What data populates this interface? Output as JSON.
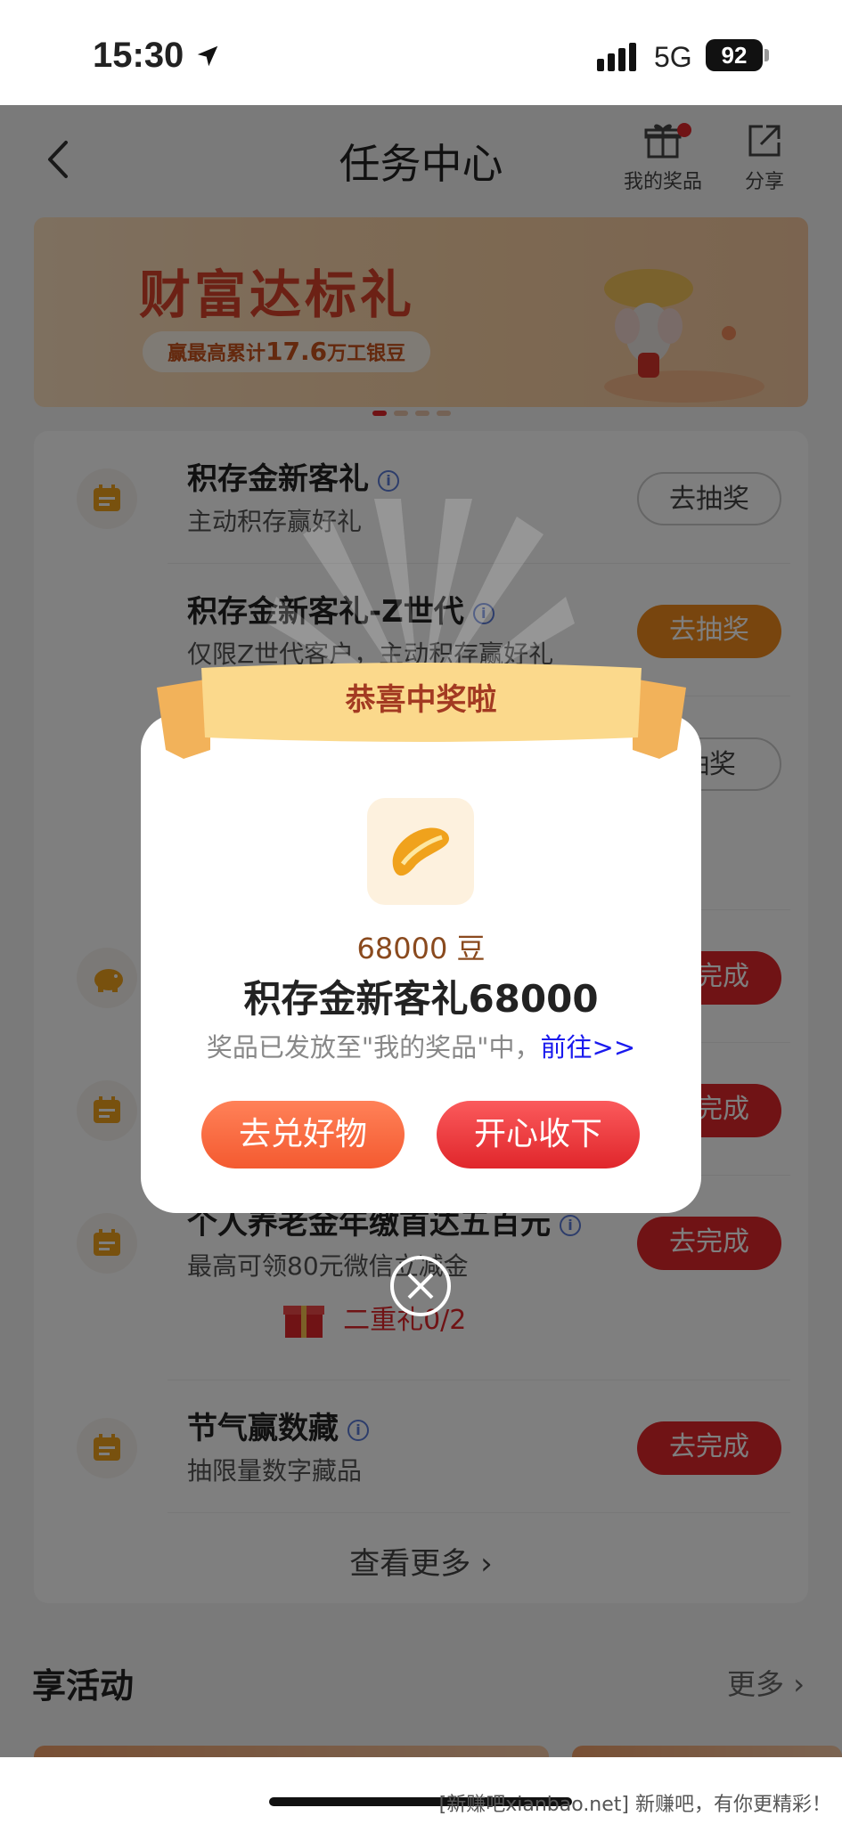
{
  "status_bar": {
    "time": "15:30",
    "network": "5G",
    "battery": "92"
  },
  "header": {
    "title": "任务中心",
    "my_prizes_label": "我的奖品",
    "share_label": "分享"
  },
  "banner": {
    "title": "财富达标礼",
    "subtitle_prefix": "赢最高累计",
    "subtitle_amount": "17.6",
    "subtitle_suffix": "万工银豆",
    "carousel_count": 4,
    "carousel_active": 0
  },
  "tasks": [
    {
      "name": "积存金新客礼",
      "desc": "主动积存赢好礼",
      "action": "去抽奖",
      "style": "outline",
      "icon": "calendar-icon"
    },
    {
      "name": "积存金新客礼-Z世代",
      "desc": "仅限Z世代客户，主动积存赢好礼",
      "action": "去抽奖",
      "style": "orange",
      "icon": "calendar-icon"
    },
    {
      "name": "",
      "desc": "",
      "action": "抽奖",
      "style": "outline",
      "icon": ""
    },
    {
      "name": "",
      "desc": "",
      "action": "去完成",
      "style": "red",
      "icon": "piggy-bank-icon"
    },
    {
      "name": "",
      "desc": "",
      "action": "去完成",
      "style": "red",
      "icon": "calendar-icon"
    },
    {
      "name": "个人养老金年缴首达五百元",
      "desc": "最高可领80元微信立减金",
      "action": "去完成",
      "style": "red",
      "icon": "calendar-icon"
    },
    {
      "name": "节气赢数藏",
      "desc": "抽限量数字藏品",
      "action": "去完成",
      "style": "red",
      "icon": "calendar-icon"
    }
  ],
  "tier_reward": "二重礼0/2",
  "view_more": "查看更多",
  "section": {
    "title": "享活动",
    "more": "更多"
  },
  "modal": {
    "ribbon_title": "恭喜中奖啦",
    "amount": "68000 豆",
    "prize_name": "积存金新客礼68000",
    "note": "奖品已发放至\"我的奖品\"中，",
    "note_link": "前往>>",
    "left_button": "去兑好物",
    "right_button": "开心收下"
  },
  "watermark": "[新赚吧xianbao.net] 新赚吧，有你更精彩！"
}
